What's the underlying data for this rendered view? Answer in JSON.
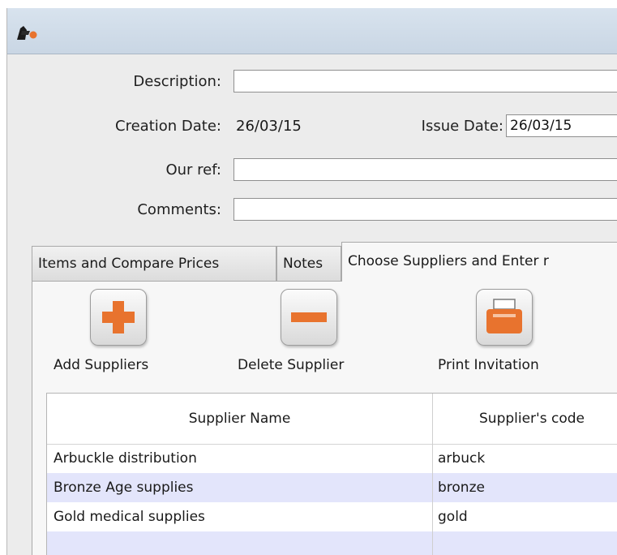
{
  "form": {
    "description_label": "Description:",
    "description_value": "",
    "creation_date_label": "Creation Date:",
    "creation_date_value": "26/03/15",
    "issue_date_label": "Issue Date:",
    "issue_date_value": "26/03/15",
    "our_ref_label": "Our ref:",
    "our_ref_value": "",
    "comments_label": "Comments:",
    "comments_value": ""
  },
  "tabs": [
    {
      "label": "Items and Compare Prices"
    },
    {
      "label": "Notes"
    },
    {
      "label": "Choose Suppliers and Enter r"
    }
  ],
  "toolbar": {
    "add_label": "Add Suppliers",
    "delete_label": "Delete Supplier",
    "print_label": "Print Invitation"
  },
  "grid": {
    "columns": [
      "Supplier Name",
      "Supplier's code"
    ],
    "rows": [
      {
        "name": "Arbuckle distribution",
        "code": "arbuck"
      },
      {
        "name": "Bronze Age supplies",
        "code": "bronze"
      },
      {
        "name": "Gold medical supplies",
        "code": "gold"
      },
      {
        "name": "",
        "code": ""
      }
    ]
  },
  "icons": {
    "app": "app-logo-icon",
    "add": "plus-icon",
    "delete": "minus-icon",
    "print": "printer-icon"
  },
  "colors": {
    "accent_orange": "#e8732e",
    "row_highlight": "#e3e5fb",
    "titlebar": "#c9d6e4"
  }
}
